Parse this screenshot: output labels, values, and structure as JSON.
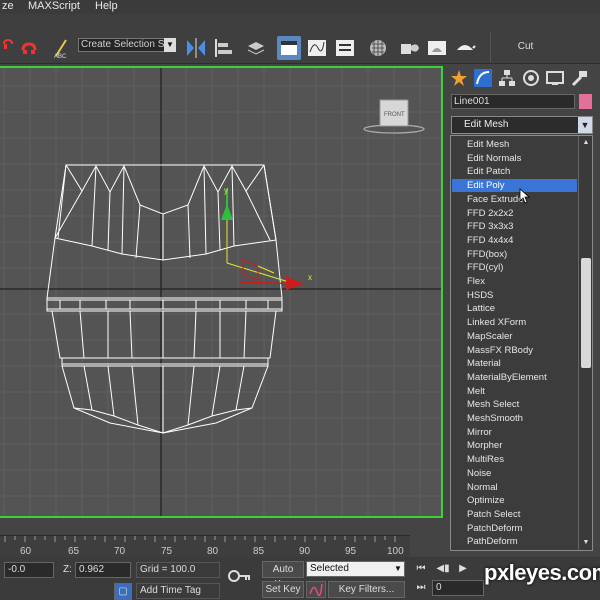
{
  "menu": {
    "items": [
      "ze",
      "MAXScript",
      "Help"
    ]
  },
  "toolbar": {
    "selection_set_value": "Create Selection Se",
    "cut_label": "Cut"
  },
  "viewport": {
    "viewcube_label": "FRONT",
    "gizmo_axis_y": "y",
    "gizmo_axis_x": "x",
    "border_color": "#3ad33a"
  },
  "command_panel": {
    "object_name": "Line001",
    "object_color": "#e36f9a",
    "modifier_list_value": "Edit Mesh",
    "modifiers": [
      "Edit Mesh",
      "Edit Normals",
      "Edit Patch",
      "Edit Poly",
      "Face Extrude",
      "FFD 2x2x2",
      "FFD 3x3x3",
      "FFD 4x4x4",
      "FFD(box)",
      "FFD(cyl)",
      "Flex",
      "HSDS",
      "Lattice",
      "Linked XForm",
      "MapScaler",
      "MassFX RBody",
      "Material",
      "MaterialByElement",
      "Melt",
      "Mesh Select",
      "MeshSmooth",
      "Mirror",
      "Morpher",
      "MultiRes",
      "Noise",
      "Normal",
      "Optimize",
      "Patch Select",
      "PatchDeform",
      "PathDeform"
    ],
    "selected_index": 3
  },
  "timeline": {
    "ticks": [
      "60",
      "65",
      "70",
      "75",
      "80",
      "85",
      "90",
      "95",
      "100"
    ]
  },
  "status": {
    "x_value": "-0.0",
    "z_label": "Z:",
    "z_value": "0.962",
    "grid_label": "Grid = 100.0",
    "add_time_tag": "Add Time Tag",
    "auto_key": "Auto Key",
    "set_key": "Set Key",
    "key_mode_value": "Selected",
    "key_filters": "Key Filters...",
    "frame_value": "0"
  },
  "watermark": "pxleyes.com"
}
